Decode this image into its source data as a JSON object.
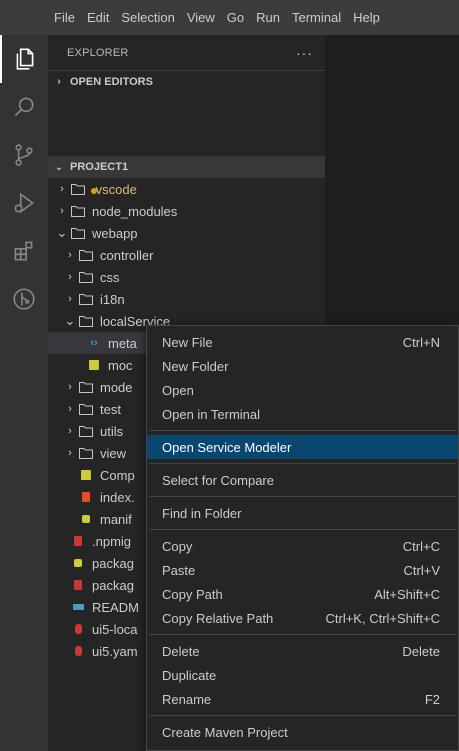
{
  "menubar": {
    "items": [
      "File",
      "Edit",
      "Selection",
      "View",
      "Go",
      "Run",
      "Terminal",
      "Help"
    ]
  },
  "activitybar": {
    "icons": [
      "files-icon",
      "search-icon",
      "source-control-icon",
      "run-debug-icon",
      "extensions-icon",
      "git-graph-icon"
    ]
  },
  "sidebar": {
    "title": "EXPLORER",
    "more": "···",
    "open_editors": "OPEN EDITORS",
    "project": "PROJECT1"
  },
  "tree": [
    {
      "label": ".vscode",
      "type": "folder",
      "level": 0,
      "expanded": false
    },
    {
      "label": "node_modules",
      "type": "folder",
      "level": 0,
      "expanded": false
    },
    {
      "label": "webapp",
      "type": "folder",
      "level": 0,
      "expanded": true
    },
    {
      "label": "controller",
      "type": "folder",
      "level": 1,
      "expanded": false
    },
    {
      "label": "css",
      "type": "folder",
      "level": 1,
      "expanded": false
    },
    {
      "label": "i18n",
      "type": "folder",
      "level": 1,
      "expanded": false
    },
    {
      "label": "localService",
      "type": "folder",
      "level": 1,
      "expanded": true
    },
    {
      "label": "meta",
      "type": "xml",
      "level": 2
    },
    {
      "label": "moc",
      "type": "js",
      "level": 2
    },
    {
      "label": "mode",
      "type": "folder",
      "level": 1,
      "expanded": false
    },
    {
      "label": "test",
      "type": "folder",
      "level": 1,
      "expanded": false
    },
    {
      "label": "utils",
      "type": "folder",
      "level": 1,
      "expanded": false
    },
    {
      "label": "view",
      "type": "folder",
      "level": 1,
      "expanded": false
    },
    {
      "label": "Comp",
      "type": "js",
      "level": 1
    },
    {
      "label": "index.",
      "type": "html",
      "level": 1
    },
    {
      "label": "manif",
      "type": "json",
      "level": 1
    },
    {
      "label": ".npmig",
      "type": "npm",
      "level": 0
    },
    {
      "label": "packag",
      "type": "json",
      "level": 0
    },
    {
      "label": "packag",
      "type": "npm",
      "level": 0
    },
    {
      "label": "READM",
      "type": "md",
      "level": 0
    },
    {
      "label": "ui5-loca",
      "type": "yaml",
      "level": 0
    },
    {
      "label": "ui5.yam",
      "type": "yaml",
      "level": 0
    }
  ],
  "context_menu": {
    "groups": [
      [
        {
          "label": "New File",
          "shortcut": "Ctrl+N"
        },
        {
          "label": "New Folder",
          "shortcut": ""
        },
        {
          "label": "Open",
          "shortcut": ""
        },
        {
          "label": "Open in Terminal",
          "shortcut": ""
        }
      ],
      [
        {
          "label": "Open Service Modeler",
          "shortcut": "",
          "highlighted": true
        }
      ],
      [
        {
          "label": "Select for Compare",
          "shortcut": ""
        }
      ],
      [
        {
          "label": "Find in Folder",
          "shortcut": ""
        }
      ],
      [
        {
          "label": "Copy",
          "shortcut": "Ctrl+C"
        },
        {
          "label": "Paste",
          "shortcut": "Ctrl+V"
        },
        {
          "label": "Copy Path",
          "shortcut": "Alt+Shift+C"
        },
        {
          "label": "Copy Relative Path",
          "shortcut": "Ctrl+K, Ctrl+Shift+C"
        }
      ],
      [
        {
          "label": "Delete",
          "shortcut": "Delete"
        },
        {
          "label": "Duplicate",
          "shortcut": ""
        },
        {
          "label": "Rename",
          "shortcut": "F2"
        }
      ],
      [
        {
          "label": "Create Maven Project",
          "shortcut": ""
        }
      ]
    ]
  },
  "colors": {
    "menubar_bg": "#3c3c3c",
    "activitybar_bg": "#333333",
    "sidebar_bg": "#252526",
    "editor_bg": "#1e1e1e",
    "menu_highlight": "#094771",
    "vscode_folder_text": "#d7ba7d",
    "modified_dot": "#cca700",
    "js_icon": "#cbcb41",
    "html_icon": "#e44d26",
    "json_icon": "#cbcb41",
    "xml_icon": "#519aba",
    "npm_icon": "#cb3837",
    "md_icon": "#519aba",
    "yaml_icon": "#cb3837"
  }
}
